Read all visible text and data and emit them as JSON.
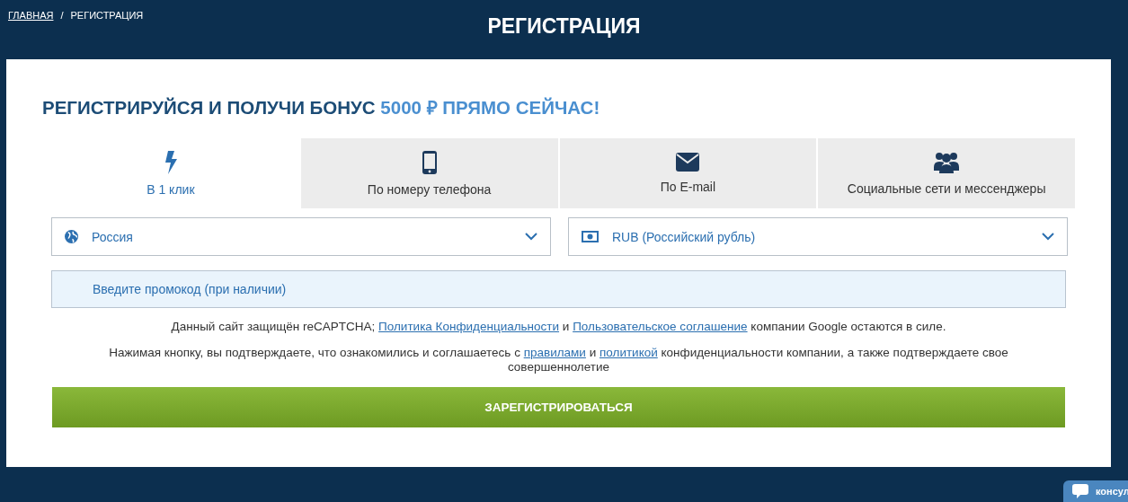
{
  "breadcrumbs": [
    {
      "label": "ГЛАВНАЯ",
      "kind": "link"
    },
    {
      "label": "/",
      "kind": "separator"
    },
    {
      "label": "РЕГИСТРАЦИЯ",
      "kind": "current"
    }
  ],
  "page_title": "РЕГИСТРАЦИЯ",
  "heading": {
    "text": "РЕГИСТРИРУЙСЯ И ПОЛУЧИ БОНУС",
    "highlight": "5000 ₽ ПРЯМО СЕЙЧАС!"
  },
  "tabs": [
    {
      "label": "В 1 клик",
      "kind": "bolt",
      "selected": true
    },
    {
      "label": "По номеру телефона",
      "kind": "phone",
      "selected": false
    },
    {
      "label": "По E-mail",
      "kind": "mail",
      "selected": false
    },
    {
      "label": "Социальные сети и мессенджеры",
      "kind": "people",
      "selected": false
    }
  ],
  "selects": [
    {
      "value": "Россия",
      "kind": "globe"
    },
    {
      "value": "RUB (Российский рубль)",
      "kind": "money"
    }
  ],
  "promo": {
    "placeholder": "Введите промокод (при наличии)"
  },
  "notes": [
    [
      {
        "kind": "text",
        "text": "Данный сайт защищён reCAPTCHA;"
      },
      {
        "kind": "link",
        "text": "Политика Конфиденциальности"
      },
      {
        "kind": "text",
        "text": "и"
      },
      {
        "kind": "link",
        "text": "Пользовательское соглашение"
      },
      {
        "kind": "text",
        "text": "компании Google остаются в силе."
      }
    ],
    [
      {
        "kind": "text",
        "text": "Нажимая кнопку, вы подтверждаете, что ознакомились и соглашаетесь с"
      },
      {
        "kind": "link",
        "text": "правилами"
      },
      {
        "kind": "text",
        "text": "и"
      },
      {
        "kind": "link",
        "text": "политикой"
      },
      {
        "kind": "text",
        "text": "конфиденциальности компании, а также подтверждаете свое совершеннолетие"
      }
    ]
  ],
  "submit": "ЗАРЕГИСТРИРОВАТЬСЯ",
  "chat": {
    "label": "консул"
  }
}
